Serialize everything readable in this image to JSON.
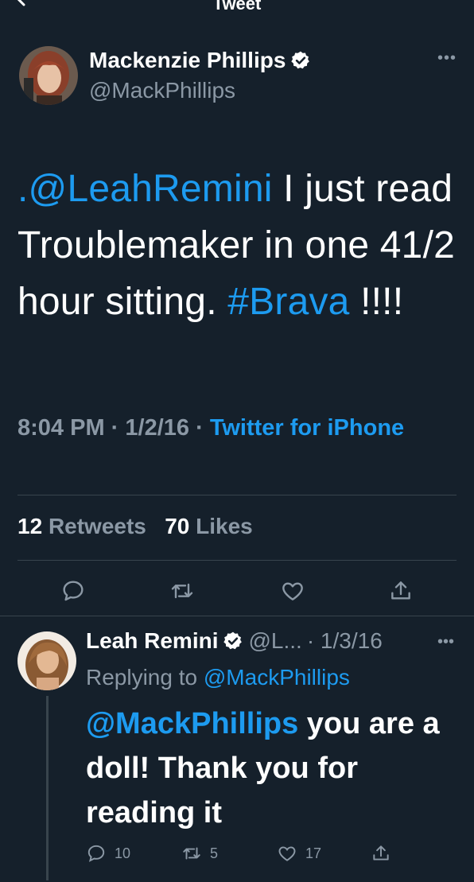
{
  "header": {
    "title": "Tweet"
  },
  "tweet": {
    "author_name": "Mackenzie Phillips",
    "author_handle": "@MackPhillips",
    "text_mention": ".@LeahRemini",
    "text_body": " I just read Troublemaker in one 41/2 hour sitting. ",
    "text_hashtag": "#Brava",
    "text_end": " !!!!",
    "time": "8:04 PM",
    "date": "1/2/16",
    "sep": " · ",
    "source": "Twitter for iPhone",
    "retweets_count": "12",
    "retweets_label": "Retweets",
    "likes_count": "70",
    "likes_label": "Likes"
  },
  "reply": {
    "author_name": "Leah Remini",
    "author_handle": "@L...",
    "date": "· 1/3/16",
    "replying_prefix": "Replying to ",
    "replying_handle": "@MackPhillips",
    "text_mention": "@MackPhillips",
    "text_body": " you are a doll! Thank you for reading it",
    "replies_count": "10",
    "retweets_count": "5",
    "likes_count": "17"
  },
  "colors": {
    "background": "#15202b",
    "accent": "#1d9bf0",
    "muted": "#8b98a5",
    "divider": "#38444d"
  },
  "icons": [
    "back-arrow-icon",
    "verified-badge-icon",
    "more-icon",
    "reply-icon",
    "retweet-icon",
    "like-icon",
    "share-icon"
  ]
}
